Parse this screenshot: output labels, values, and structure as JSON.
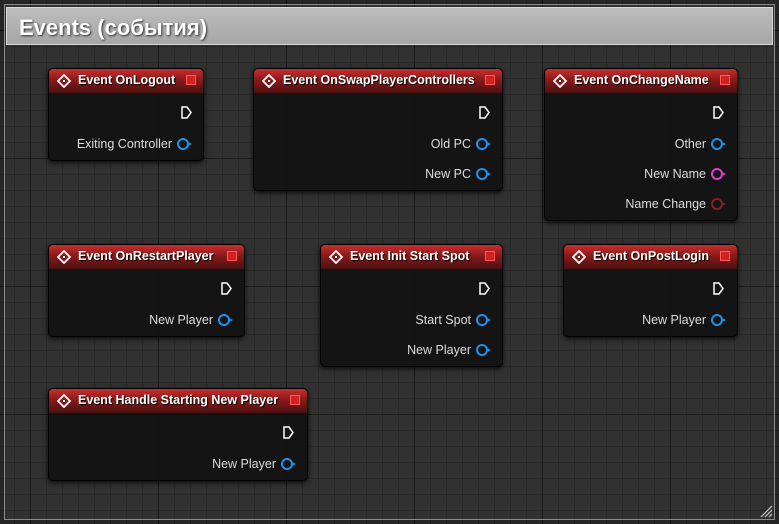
{
  "comment": {
    "title": "Events (события)"
  },
  "nodes": [
    {
      "id": "onlogout",
      "title": "Event OnLogout",
      "pins": [
        {
          "label": "Exiting Controller",
          "color": "#1e90e8"
        }
      ]
    },
    {
      "id": "onswap",
      "title": "Event OnSwapPlayerControllers",
      "pins": [
        {
          "label": "Old PC",
          "color": "#1e90e8"
        },
        {
          "label": "New PC",
          "color": "#1e90e8"
        }
      ]
    },
    {
      "id": "onchangename",
      "title": "Event OnChangeName",
      "pins": [
        {
          "label": "Other",
          "color": "#1e90e8"
        },
        {
          "label": "New Name",
          "color": "#e33bd6"
        },
        {
          "label": "Name Change",
          "color": "#8a1e1e"
        }
      ]
    },
    {
      "id": "onrestart",
      "title": "Event OnRestartPlayer",
      "pins": [
        {
          "label": "New Player",
          "color": "#1e90e8"
        }
      ]
    },
    {
      "id": "initstart",
      "title": "Event Init Start Spot",
      "pins": [
        {
          "label": "Start Spot",
          "color": "#1e90e8"
        },
        {
          "label": "New Player",
          "color": "#1e90e8"
        }
      ]
    },
    {
      "id": "onpostlogin",
      "title": "Event OnPostLogin",
      "pins": [
        {
          "label": "New Player",
          "color": "#1e90e8"
        }
      ]
    },
    {
      "id": "handlestart",
      "title": "Event Handle Starting New Player",
      "pins": [
        {
          "label": "New Player",
          "color": "#1e90e8"
        }
      ]
    }
  ]
}
